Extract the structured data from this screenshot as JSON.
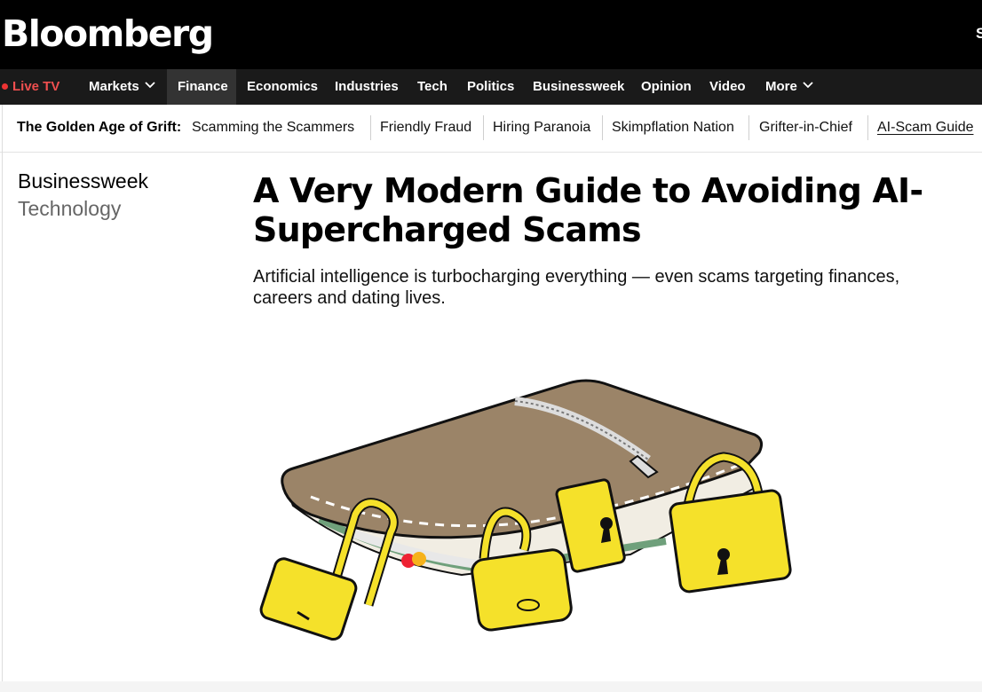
{
  "brand": {
    "logo_text": "Bloomberg",
    "right_label": "S"
  },
  "nav": {
    "live_tv": "Live TV",
    "items": [
      "Markets",
      "Finance",
      "Economics",
      "Industries",
      "Tech",
      "Politics",
      "Businessweek",
      "Opinion",
      "Video",
      "More"
    ],
    "active": "Finance"
  },
  "subnav": {
    "title": "The Golden Age of Grift:",
    "links": [
      "Scamming the Scammers",
      "Friendly Fraud",
      "Hiring Paranoia",
      "Skimpflation Nation",
      "Grifter-in-Chief",
      "AI-Scam Guide"
    ],
    "current": "AI-Scam Guide"
  },
  "article": {
    "section": "Businessweek",
    "subsection": "Technology",
    "headline": "A Very Modern Guide to Avoiding AI-Supercharged Scams",
    "dek": "Artificial intelligence is turbocharging everything — even scams targeting finances, careers and dating lives."
  },
  "illustration": {
    "subject": "wallet locked with padlocks",
    "wallet_color": "#9b8468",
    "lock_color": "#f5e12a"
  },
  "colors": {
    "live_red": "#f04f4f",
    "nav_bg": "#1a1a1a",
    "topbar_bg": "#000000"
  }
}
